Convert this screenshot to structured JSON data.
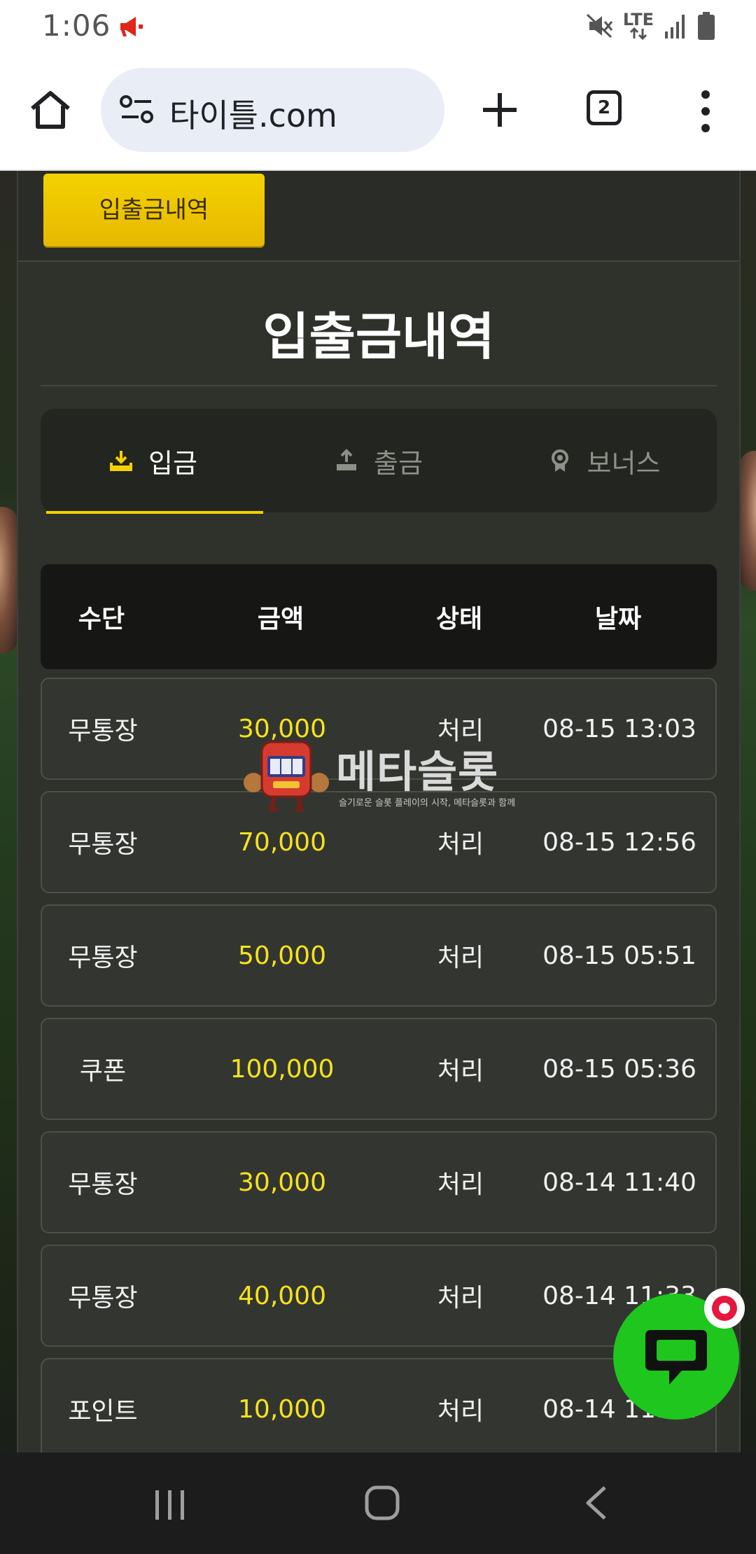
{
  "status_bar": {
    "time": "1:06",
    "network": "LTE",
    "icons": [
      "megaphone-icon",
      "mute-icon",
      "lte-icon",
      "signal-icon",
      "battery-icon"
    ]
  },
  "browser": {
    "url": "타이틀.com",
    "tab_count": "2",
    "icons": [
      "home-icon",
      "site-settings-icon",
      "new-tab-icon",
      "tab-switcher-icon",
      "more-menu-icon"
    ]
  },
  "page": {
    "header_button": "입출금내역",
    "title": "입출금내역",
    "tabs": [
      {
        "label": "입금",
        "icon": "download-icon",
        "active": true
      },
      {
        "label": "출금",
        "icon": "upload-icon",
        "active": false
      },
      {
        "label": "보너스",
        "icon": "badge-icon",
        "active": false
      }
    ],
    "accent_color": "#f2d100",
    "amount_color": "#f7e21d",
    "table": {
      "headers": [
        "수단",
        "금액",
        "상태",
        "날짜"
      ],
      "rows": [
        [
          "무통장",
          "30,000",
          "처리",
          "08-15 13:03"
        ],
        [
          "무통장",
          "70,000",
          "처리",
          "08-15 12:56"
        ],
        [
          "무통장",
          "50,000",
          "처리",
          "08-15 05:51"
        ],
        [
          "쿠폰",
          "100,000",
          "처리",
          "08-15 05:36"
        ],
        [
          "무통장",
          "30,000",
          "처리",
          "08-14 11:40"
        ],
        [
          "무통장",
          "40,000",
          "처리",
          "08-14 11:33"
        ],
        [
          "포인트",
          "10,000",
          "처리",
          "08-14 11:31"
        ]
      ]
    }
  },
  "watermark": {
    "title": "메타슬롯",
    "subtitle": "슬기로운 슬롯 플레이의 시작, 메타슬롯과 함께"
  },
  "chat_button": {
    "icon": "chat-icon",
    "color": "#1ec61e"
  },
  "nav_bar": {
    "icons": [
      "recents-icon",
      "home-nav-icon",
      "back-icon"
    ]
  }
}
